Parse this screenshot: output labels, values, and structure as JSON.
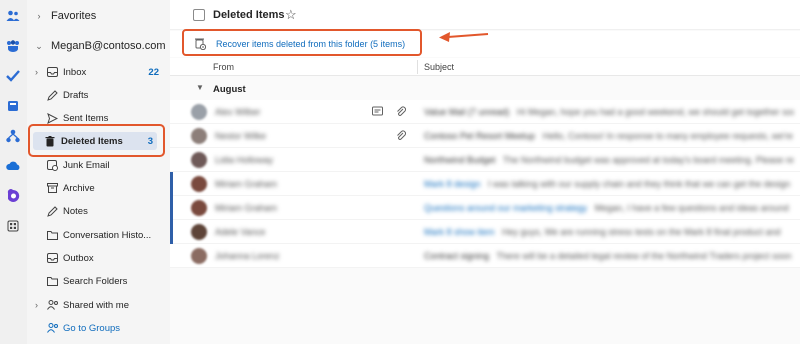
{
  "folder_pane": {
    "favorites": "Favorites",
    "account": "MeganB@contoso.com",
    "folders": [
      {
        "label": "Inbox",
        "count": "22"
      },
      {
        "label": "Drafts",
        "count": ""
      },
      {
        "label": "Sent Items",
        "count": ""
      },
      {
        "label": "Deleted Items",
        "count": "3"
      },
      {
        "label": "Junk Email",
        "count": ""
      },
      {
        "label": "Archive",
        "count": ""
      },
      {
        "label": "Notes",
        "count": ""
      },
      {
        "label": "Conversation Histo...",
        "count": ""
      },
      {
        "label": "Outbox",
        "count": ""
      },
      {
        "label": "Search Folders",
        "count": ""
      },
      {
        "label": "Shared with me",
        "count": ""
      },
      {
        "label": "Go to Groups",
        "count": ""
      }
    ]
  },
  "main": {
    "title": "Deleted Items",
    "recover_link": "Recover items deleted from this folder (5 items)",
    "columns": {
      "from": "From",
      "subject": "Subject"
    },
    "group_label": "August",
    "rows": [
      {
        "sender": "Alex Wilber",
        "subject": "Value Mail (7 unread)",
        "preview": "Hi Megan, hope you had a good weekend, we should get together soon"
      },
      {
        "sender": "Nestor Wilke",
        "subject": "Contoso Pet Resort Meetup",
        "preview": "Hello, Contoso! In response to many employee requests, we're hosting"
      },
      {
        "sender": "Lidia Holloway",
        "subject": "Northwind Budget",
        "preview": "The Northwind budget was approved at today's board meeting. Please review"
      },
      {
        "sender": "Miriam Graham",
        "subject": "Mark 8 design",
        "preview": "I was talking with our supply chain and they think that we can get the design"
      },
      {
        "sender": "Miriam Graham",
        "subject": "Questions around our marketing strategy",
        "preview": "Megan, I have a few questions and ideas around"
      },
      {
        "sender": "Adele Vance",
        "subject": "Mark 8 show item",
        "preview": "Hey guys, We are running stress tests on the Mark 8 final product and"
      },
      {
        "sender": "Johanna Lorenz",
        "subject": "Contract signing",
        "preview": "There will be a detailed legal review of the Northwind Traders project soon"
      }
    ]
  },
  "colors": {
    "accent": "#0f6cbd",
    "highlight": "#e2572c",
    "selected": "#dce3ef"
  },
  "icons": [
    "people-icon",
    "teams-icon",
    "todo-icon",
    "onedrive-icon",
    "apps-icon",
    "trash-icon",
    "star-icon",
    "recover-icon",
    "attachment-icon",
    "message-icon"
  ]
}
